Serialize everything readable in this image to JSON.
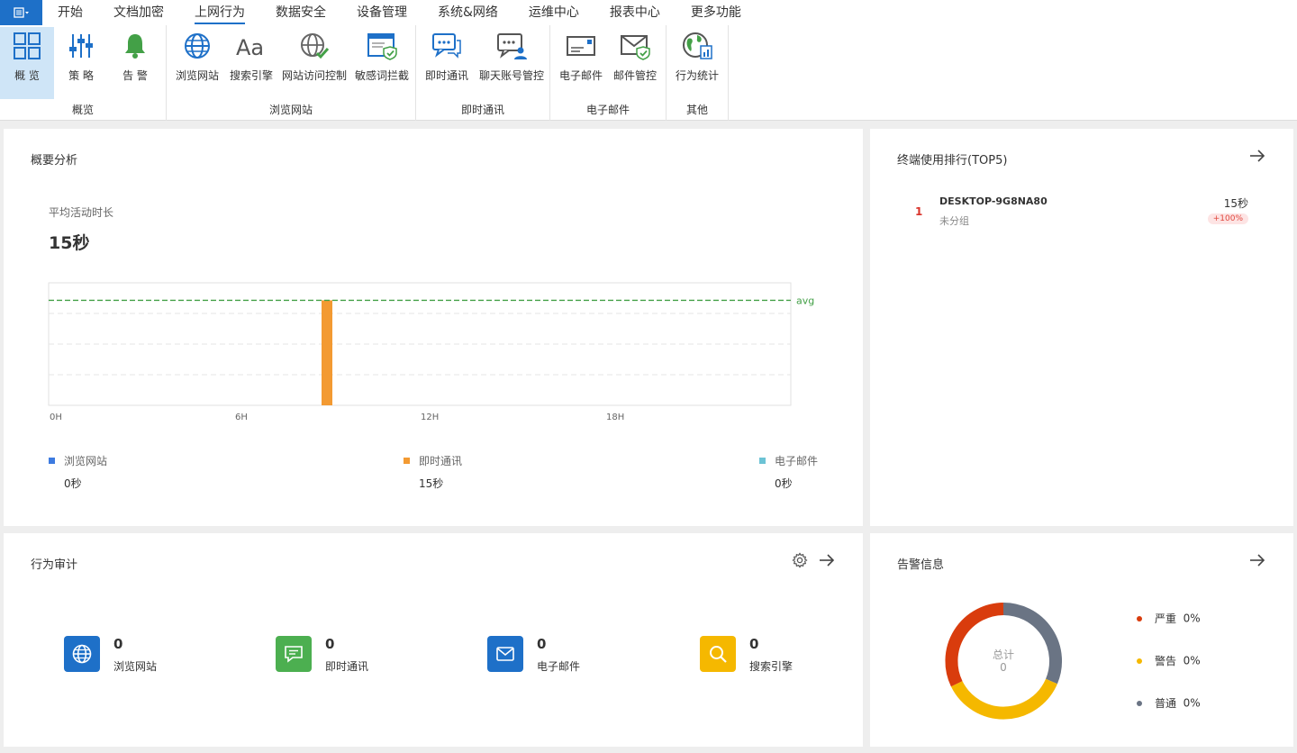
{
  "menu": {
    "items": [
      "开始",
      "文档加密",
      "上网行为",
      "数据安全",
      "设备管理",
      "系统&网络",
      "运维中心",
      "报表中心",
      "更多功能"
    ],
    "active": "上网行为"
  },
  "ribbon": {
    "groups": {
      "overview": "概览",
      "browse": "浏览网站",
      "im": "即时通讯",
      "email": "电子邮件",
      "other": "其他"
    },
    "buttons": {
      "overview": "概 览",
      "policy": "策 略",
      "alert": "告 警",
      "browse_web": "浏览网站",
      "search_engine": "搜索引擎",
      "site_access": "网站访问控制",
      "sensitive": "敏感词拦截",
      "im": "即时通讯",
      "chat_account": "聊天账号管控",
      "email": "电子邮件",
      "email_control": "邮件管控",
      "behavior_stats": "行为统计"
    }
  },
  "summary": {
    "title": "概要分析",
    "avg_label": "平均活动时长",
    "avg_value": "15秒",
    "legend": [
      {
        "name": "浏览网站",
        "value": "0秒",
        "color": "#3d7be0"
      },
      {
        "name": "即时通讯",
        "value": "15秒",
        "color": "#f39a32"
      },
      {
        "name": "电子邮件",
        "value": "0秒",
        "color": "#6cc3d5"
      }
    ]
  },
  "chart_data": {
    "type": "bar",
    "x_ticks": [
      "0H",
      "6H",
      "12H",
      "18H"
    ],
    "x_range": [
      0,
      24
    ],
    "bars": [
      {
        "hour": 9,
        "value": 15,
        "color": "#f39a32"
      }
    ],
    "avg_value": 15,
    "avg_label": "avg",
    "ylim": [
      0,
      17.5
    ],
    "grid": true
  },
  "ranking": {
    "title": "终端使用排行(TOP5)",
    "items": [
      {
        "rank": "1",
        "name": "DESKTOP-9G8NA80",
        "group": "未分组",
        "value": "15秒",
        "change": "+100%"
      }
    ]
  },
  "audit": {
    "title": "行为审计",
    "items": [
      {
        "count": "0",
        "name": "浏览网站",
        "color": "#1e70c8"
      },
      {
        "count": "0",
        "name": "即时通讯",
        "color": "#4caf50"
      },
      {
        "count": "0",
        "name": "电子邮件",
        "color": "#1e70c8"
      },
      {
        "count": "0",
        "name": "搜索引擎",
        "color": "#f5b800"
      }
    ]
  },
  "alerts": {
    "title": "告警信息",
    "total_label": "总计",
    "total_value": "0",
    "legend": [
      {
        "name": "严重",
        "value": "0%",
        "color": "#d93c0d"
      },
      {
        "name": "警告",
        "value": "0%",
        "color": "#f5b800"
      },
      {
        "name": "普通",
        "value": "0%",
        "color": "#6a7484"
      }
    ]
  }
}
